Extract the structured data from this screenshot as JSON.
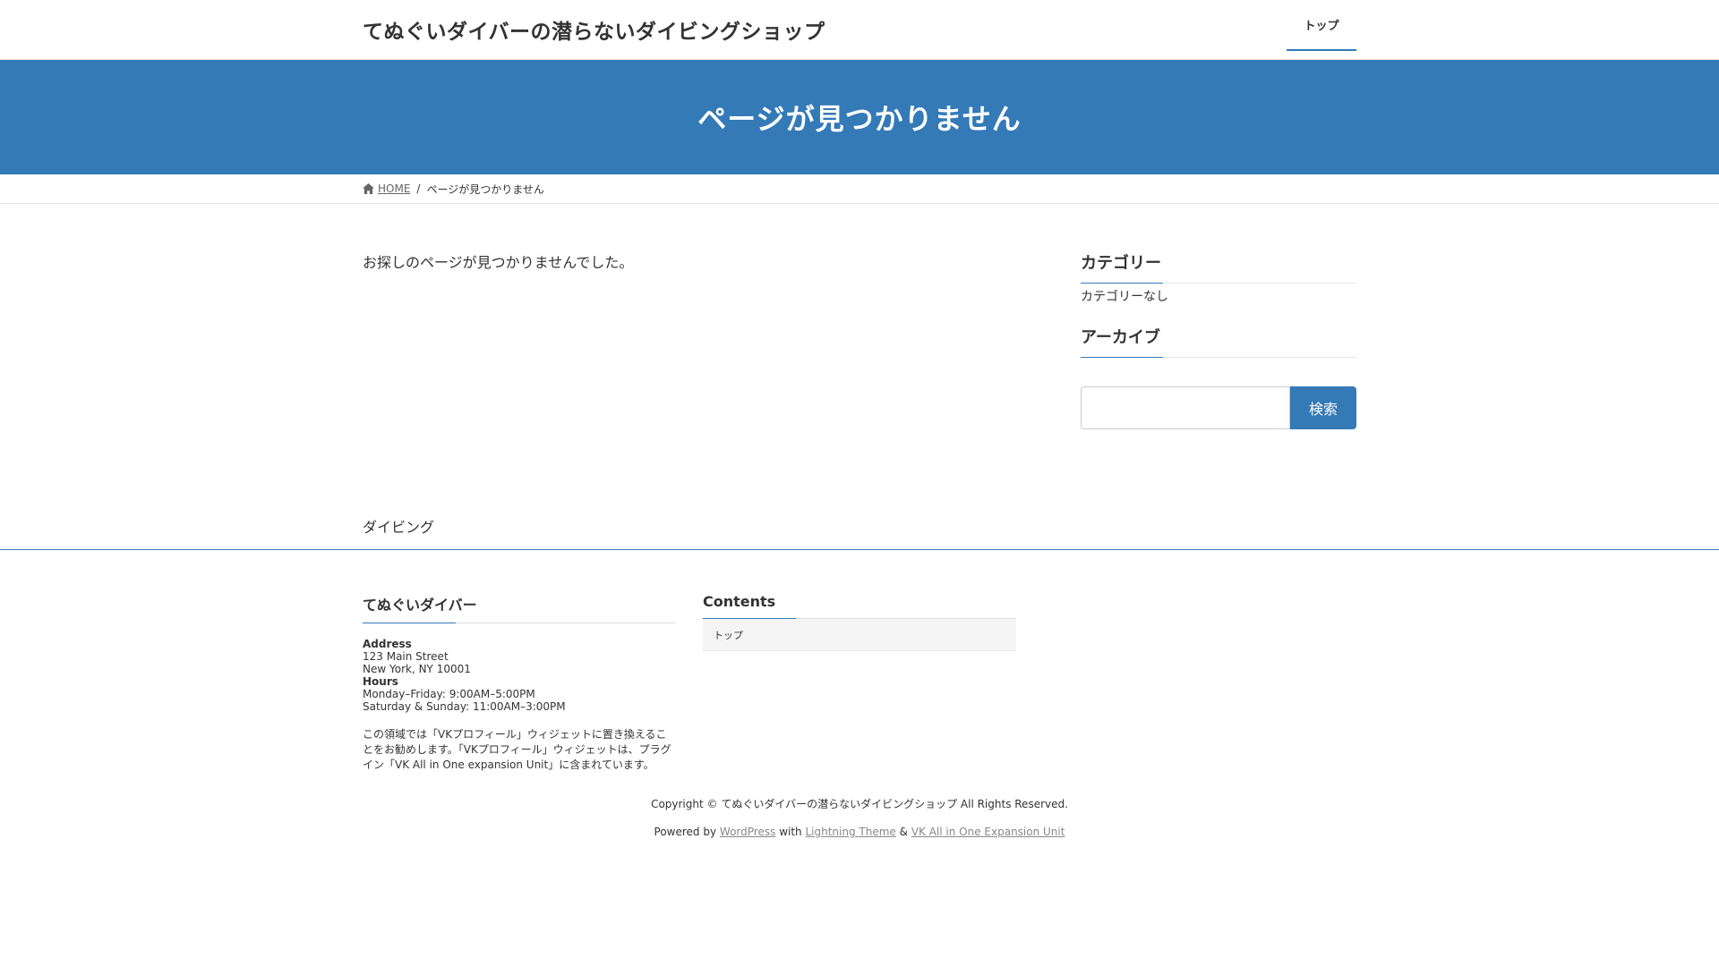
{
  "header": {
    "site_title": "てぬぐいダイバーの潜らないダイビングショップ",
    "nav": [
      {
        "label": "トップ"
      }
    ]
  },
  "page_header": {
    "title": "ページが見つかりません"
  },
  "breadcrumb": {
    "home": "HOME",
    "separator": "/",
    "current": "ページが見つかりません"
  },
  "main": {
    "message": "お探しのページが見つかりませんでした。"
  },
  "sidebar": {
    "categories": {
      "title": "カテゴリー",
      "empty_text": "カテゴリーなし"
    },
    "archives": {
      "title": "アーカイブ"
    },
    "search": {
      "placeholder": "",
      "button_label": "検索"
    }
  },
  "pre_footer": {
    "text": "ダイビング"
  },
  "footer": {
    "profile": {
      "title": "てぬぐいダイバー",
      "address_label": "Address",
      "address_line1": "123 Main Street",
      "address_line2": "New York, NY 10001",
      "hours_label": "Hours",
      "hours_line1": "Monday–Friday: 9:00AM–5:00PM",
      "hours_line2": "Saturday & Sunday: 11:00AM–3:00PM",
      "description": "この領域では「VKプロフィール」ウィジェットに置き換えることをお勧めします。「VKプロフィール」ウィジェットは、プラグイン「VK All in One expansion Unit」に含まれています。"
    },
    "contents": {
      "title": "Contents",
      "items": [
        {
          "label": "トップ"
        }
      ]
    },
    "copyright": "Copyright © てぬぐいダイバーの潜らないダイビングショップ All Rights Reserved.",
    "powered": {
      "prefix": "Powered by",
      "wordpress": "WordPress",
      "with": "with",
      "theme": "Lightning Theme",
      "amp": "&",
      "plugin": "VK All in One Expansion Unit"
    }
  },
  "colors": {
    "accent": "#337ab7"
  }
}
